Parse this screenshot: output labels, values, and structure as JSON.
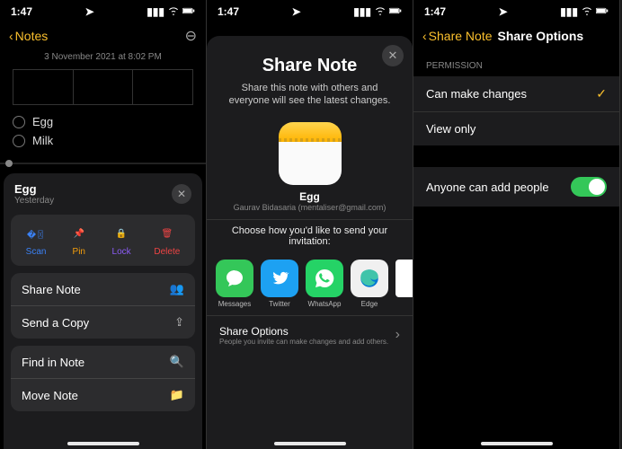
{
  "status": {
    "time": "1:47",
    "loc_icon": "location"
  },
  "screen1": {
    "back": "Notes",
    "date": "3 November 2021 at 8:02 PM",
    "items": [
      "Egg",
      "Milk"
    ],
    "sheet": {
      "title": "Egg",
      "subtitle": "Yesterday",
      "actions": [
        {
          "label": "Scan"
        },
        {
          "label": "Pin"
        },
        {
          "label": "Lock"
        },
        {
          "label": "Delete"
        }
      ],
      "menu1": [
        "Share Note",
        "Send a Copy"
      ],
      "menu2": [
        "Find in Note",
        "Move Note"
      ]
    }
  },
  "screen2": {
    "title": "Share Note",
    "desc": "Share this note with others and everyone will see the latest changes.",
    "note_name": "Egg",
    "author": "Gaurav Bidasaria (mentaliser@gmail.com)",
    "invite": "Choose how you'd like to send your invitation:",
    "apps": [
      "Messages",
      "Twitter",
      "WhatsApp",
      "Edge"
    ],
    "share_options": {
      "title": "Share Options",
      "sub": "People you invite can make changes and add others."
    }
  },
  "screen3": {
    "back": "Share Note",
    "title": "Share Options",
    "section": "PERMISSION",
    "opts": [
      "Can make changes",
      "View only"
    ],
    "toggle_label": "Anyone can add people",
    "toggle_on": true
  }
}
